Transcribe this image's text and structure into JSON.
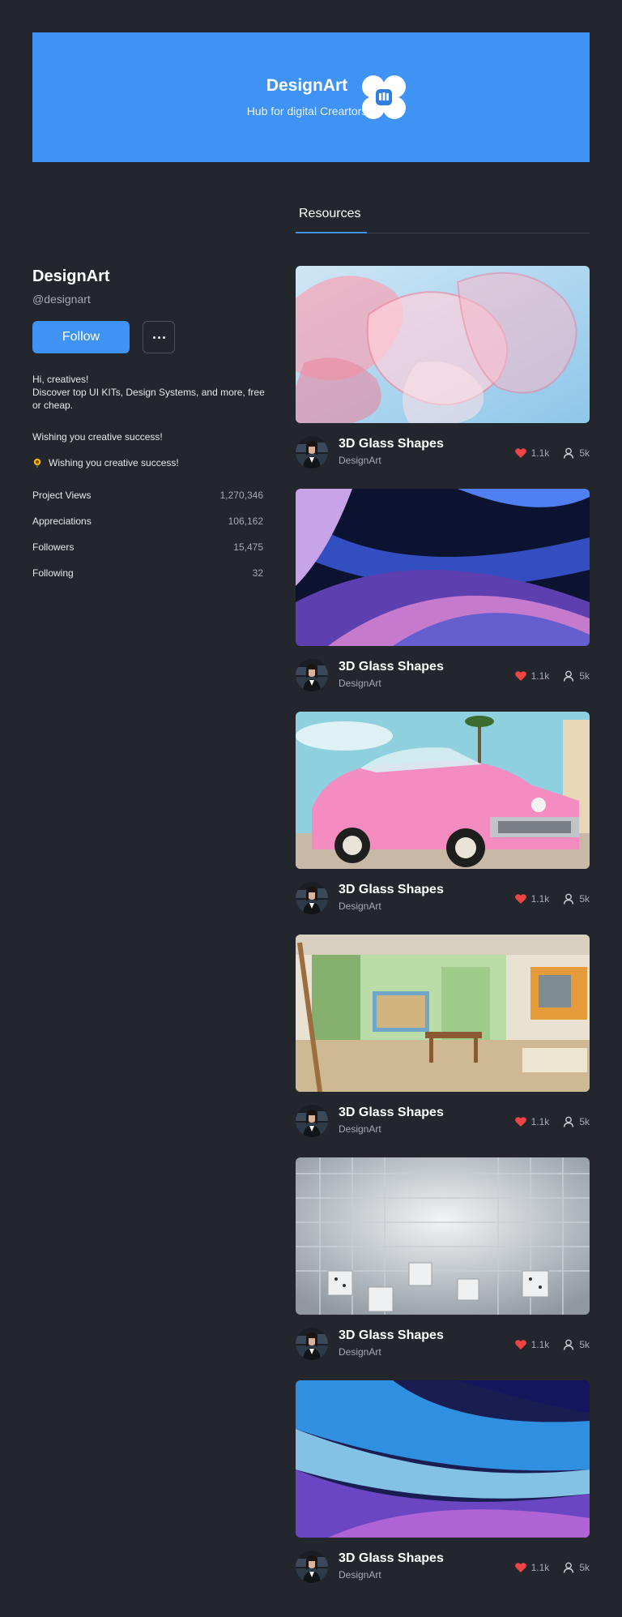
{
  "banner": {
    "title": "DesignArt",
    "subtitle": "Hub for digital Creartors",
    "logo_icon": "designart-logo-icon",
    "color": "#3f93f4"
  },
  "tabs": [
    {
      "label": "Resources",
      "active": true
    }
  ],
  "profile": {
    "name": "DesignArt",
    "handle": "@designart",
    "follow_label": "Follow",
    "more_icon": "more-dots-icon",
    "bio": "Hi, creatives!\nDiscover top UI KITs, Design Systems, and more, free or cheap.",
    "bio_line2": "Wishing you creative success!",
    "bio_line3": "Wishing you creative success!",
    "bio_line3_icon": "sunflower-icon"
  },
  "stats": [
    {
      "label": "Project Views",
      "value": "1,270,346"
    },
    {
      "label": "Appreciations",
      "value": "106,162"
    },
    {
      "label": "Followers",
      "value": "15,475"
    },
    {
      "label": "Following",
      "value": "32"
    }
  ],
  "cards": [
    {
      "title": "3D Glass Shapes",
      "author": "DesignArt",
      "likes": "1.1k",
      "views": "5k",
      "image": "pink-glass-shapes"
    },
    {
      "title": "3D Glass Shapes",
      "author": "DesignArt",
      "likes": "1.1k",
      "views": "5k",
      "image": "blue-purple-waves"
    },
    {
      "title": "3D Glass Shapes",
      "author": "DesignArt",
      "likes": "1.1k",
      "views": "5k",
      "image": "pink-vintage-car"
    },
    {
      "title": "3D Glass Shapes",
      "author": "DesignArt",
      "likes": "1.1k",
      "views": "5k",
      "image": "art-studio"
    },
    {
      "title": "3D Glass Shapes",
      "author": "DesignArt",
      "likes": "1.1k",
      "views": "5k",
      "image": "white-grid-cubes"
    },
    {
      "title": "3D Glass Shapes",
      "author": "DesignArt",
      "likes": "1.1k",
      "views": "5k",
      "image": "blue-glass-waves"
    }
  ],
  "colors": {
    "accent": "#3f93f4",
    "background": "#23272d",
    "heart": "#ef4444"
  }
}
